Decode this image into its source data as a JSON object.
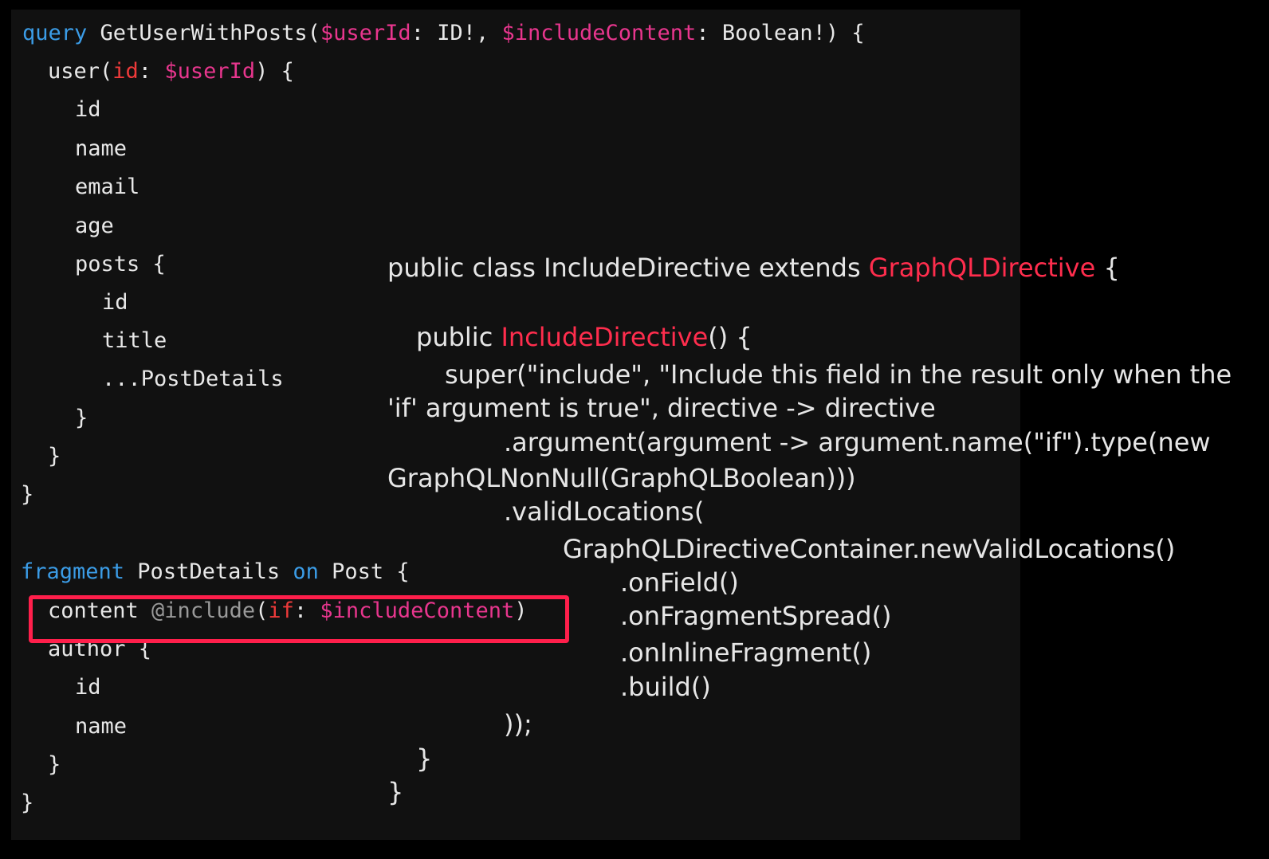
{
  "graphql": {
    "q_kw": "query",
    "q_name": "GetUserWithPosts(",
    "q_var1": "$userId",
    "q_t1": ": ID!, ",
    "q_var2": "$includeContent",
    "q_t2": ": Boolean!) {",
    "u_name": "user(",
    "u_arg": "id",
    "u_colon": ": ",
    "u_var": "$userId",
    "u_close": ") {",
    "f_id": "id",
    "f_name": "name",
    "f_email": "email",
    "f_age": "age",
    "f_posts": "posts {",
    "p_id": "id",
    "p_title": "title",
    "p_spread": "...PostDetails",
    "c1": "}",
    "c2": "}",
    "c3": "}",
    "fr_kw": "fragment",
    "fr_name": " PostDetails ",
    "fr_on": "on",
    "fr_type": " Post {",
    "ct_field": "content ",
    "ct_dir": "@include",
    "ct_open": "(",
    "ct_arg": "if",
    "ct_colon": ": ",
    "ct_var": "$includeContent",
    "ct_close": ")",
    "a_open": "author {",
    "a_id": "id",
    "a_name": "name",
    "a_close": "}",
    "fr_close": "}"
  },
  "java": {
    "l1_a": "public class IncludeDirective extends ",
    "l1_b": "GraphQLDirective",
    "l1_c": " {",
    "l2_a": "public ",
    "l2_b": "IncludeDirective",
    "l2_c": "() {",
    "l3": "super(\"include\", \"Include this field in the result only when the",
    "l4": "'if' argument is true\", directive -> directive",
    "l5": ".argument(argument -> argument.name(\"if\").type(new",
    "l6": "GraphQLNonNull(GraphQLBoolean)))",
    "l7": ".validLocations(",
    "l8": "GraphQLDirectiveContainer.newValidLocations()",
    "l9": ".onField()",
    "l10": ".onFragmentSpread()",
    "l11": ".onInlineFragment()",
    "l12": ".build()",
    "l13": "));",
    "l14": "}",
    "l15": "}"
  },
  "colors": {
    "keyword": "#3b9ce6",
    "variable": "#e8368e",
    "argument": "#ee3a3a",
    "directive": "#9a9a9a",
    "highlight": "#ff1f4b",
    "class_name": "#ff2d4d"
  }
}
